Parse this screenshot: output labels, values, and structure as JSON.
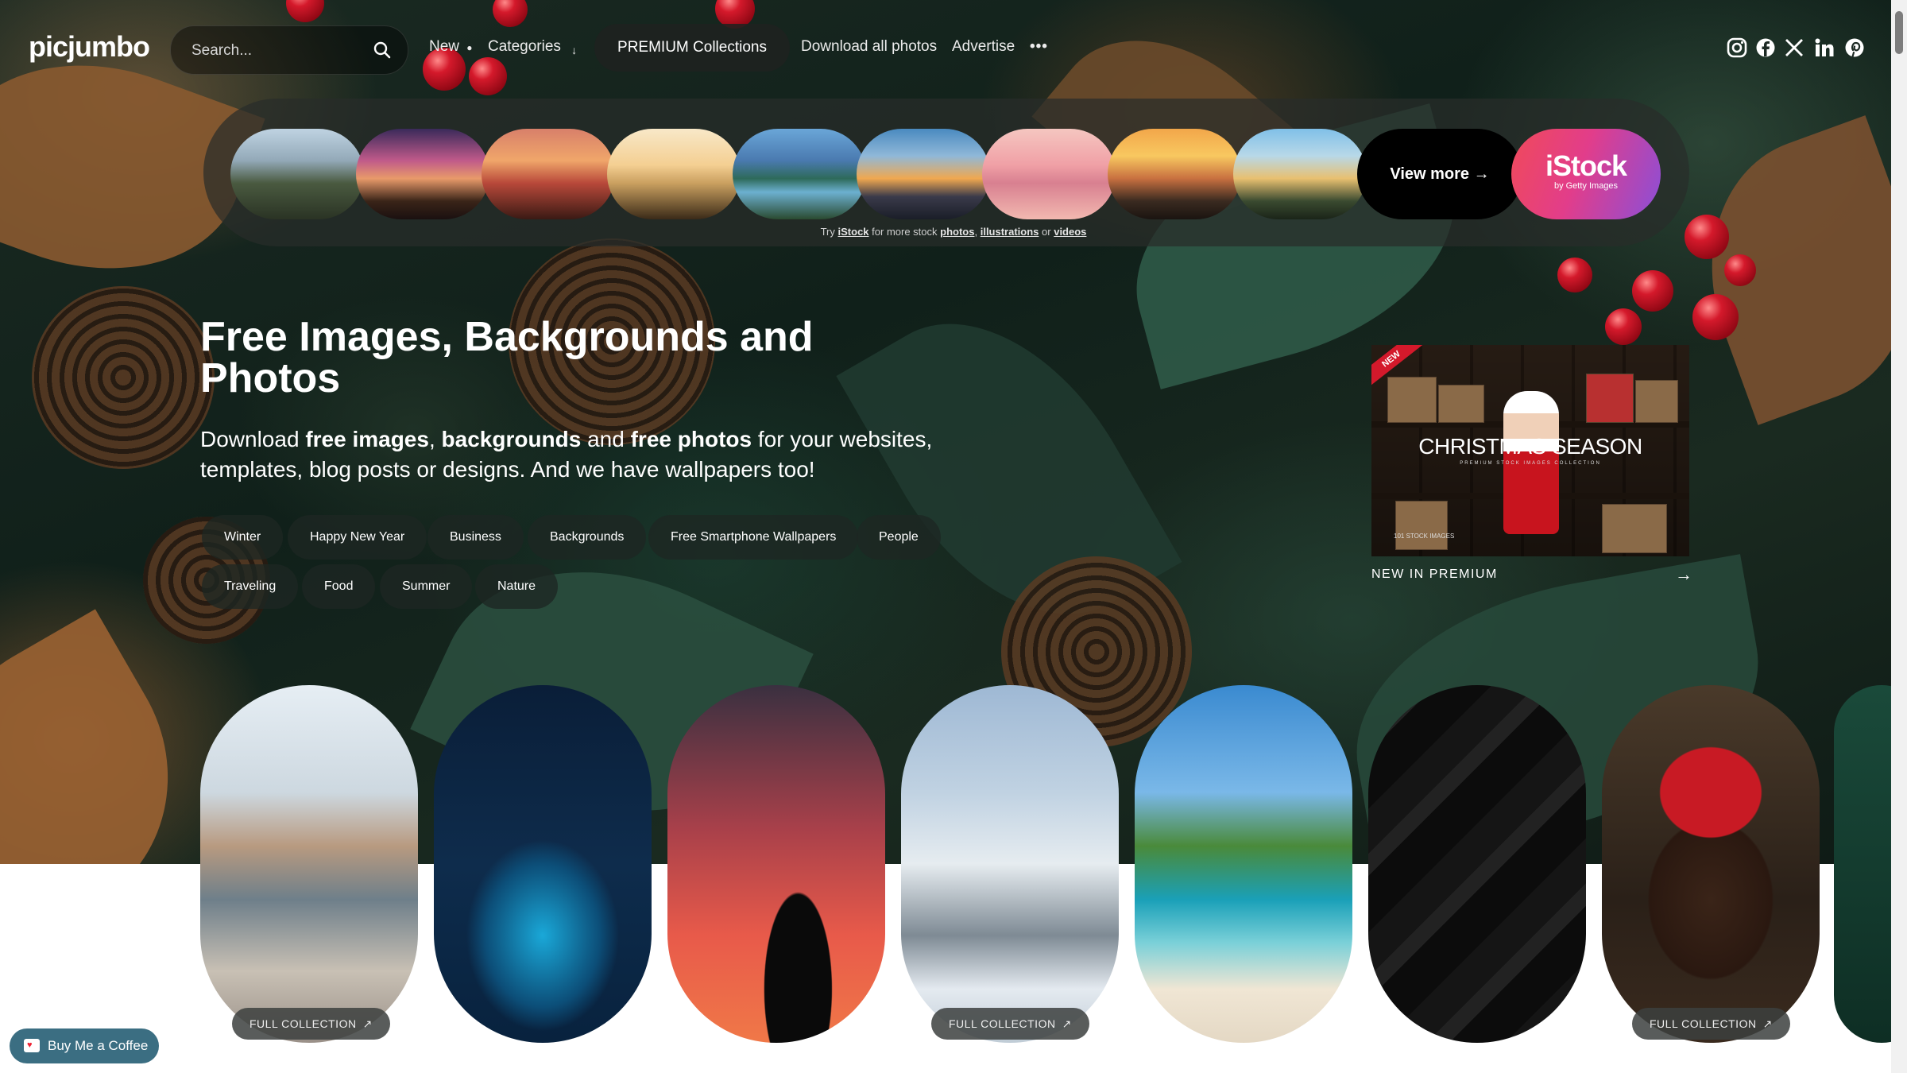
{
  "nav": {
    "logo": "picjumbo",
    "search_placeholder": "Search...",
    "new_label": "New",
    "categories_label": "Categories",
    "premium_label": "PREMIUM Collections",
    "download_label": "Download all photos",
    "advertise_label": "Advertise",
    "more_label": "•••",
    "social": [
      "instagram-icon",
      "facebook-icon",
      "x-icon",
      "linkedin-icon",
      "pinterest-icon"
    ]
  },
  "strip": {
    "view_more": "View more →",
    "istock_big": "iStock",
    "istock_small": "by Getty Images",
    "caption_try": "Try",
    "caption_istock": "iStock",
    "caption_for": "for more stock",
    "caption_photos": "photos",
    "caption_comma": ",",
    "caption_illustrations": "illustrations",
    "caption_or": "or",
    "caption_videos": "videos"
  },
  "hero": {
    "title": "Free Images, Backgrounds and Photos",
    "desc_1": "Download ",
    "desc_b1": "free images",
    "desc_2": ", ",
    "desc_b2": "backgrounds",
    "desc_3": " and ",
    "desc_b3": "free photos",
    "desc_4": " for your websites, templates, blog posts or designs. And we have wallpapers too!",
    "tags": [
      "Winter",
      "Happy New Year",
      "Business",
      "Backgrounds",
      "Free Smartphone Wallpapers",
      "People",
      "Traveling",
      "Food",
      "Summer",
      "Nature"
    ]
  },
  "promo": {
    "ribbon": "NEW",
    "title": "CHRISTMAS SEASON",
    "subtitle": "PREMIUM STOCK IMAGES COLLECTION",
    "count": "101 STOCK IMAGES",
    "label": "NEW IN PREMIUM",
    "arrow": "→"
  },
  "cards": {
    "full_collection": "FULL COLLECTION"
  },
  "bmc": {
    "label": "Buy Me a Coffee"
  },
  "colors": {
    "accent": "#3b6e82",
    "berry": "#d4192b",
    "istock_pink": "#e23d8a"
  }
}
